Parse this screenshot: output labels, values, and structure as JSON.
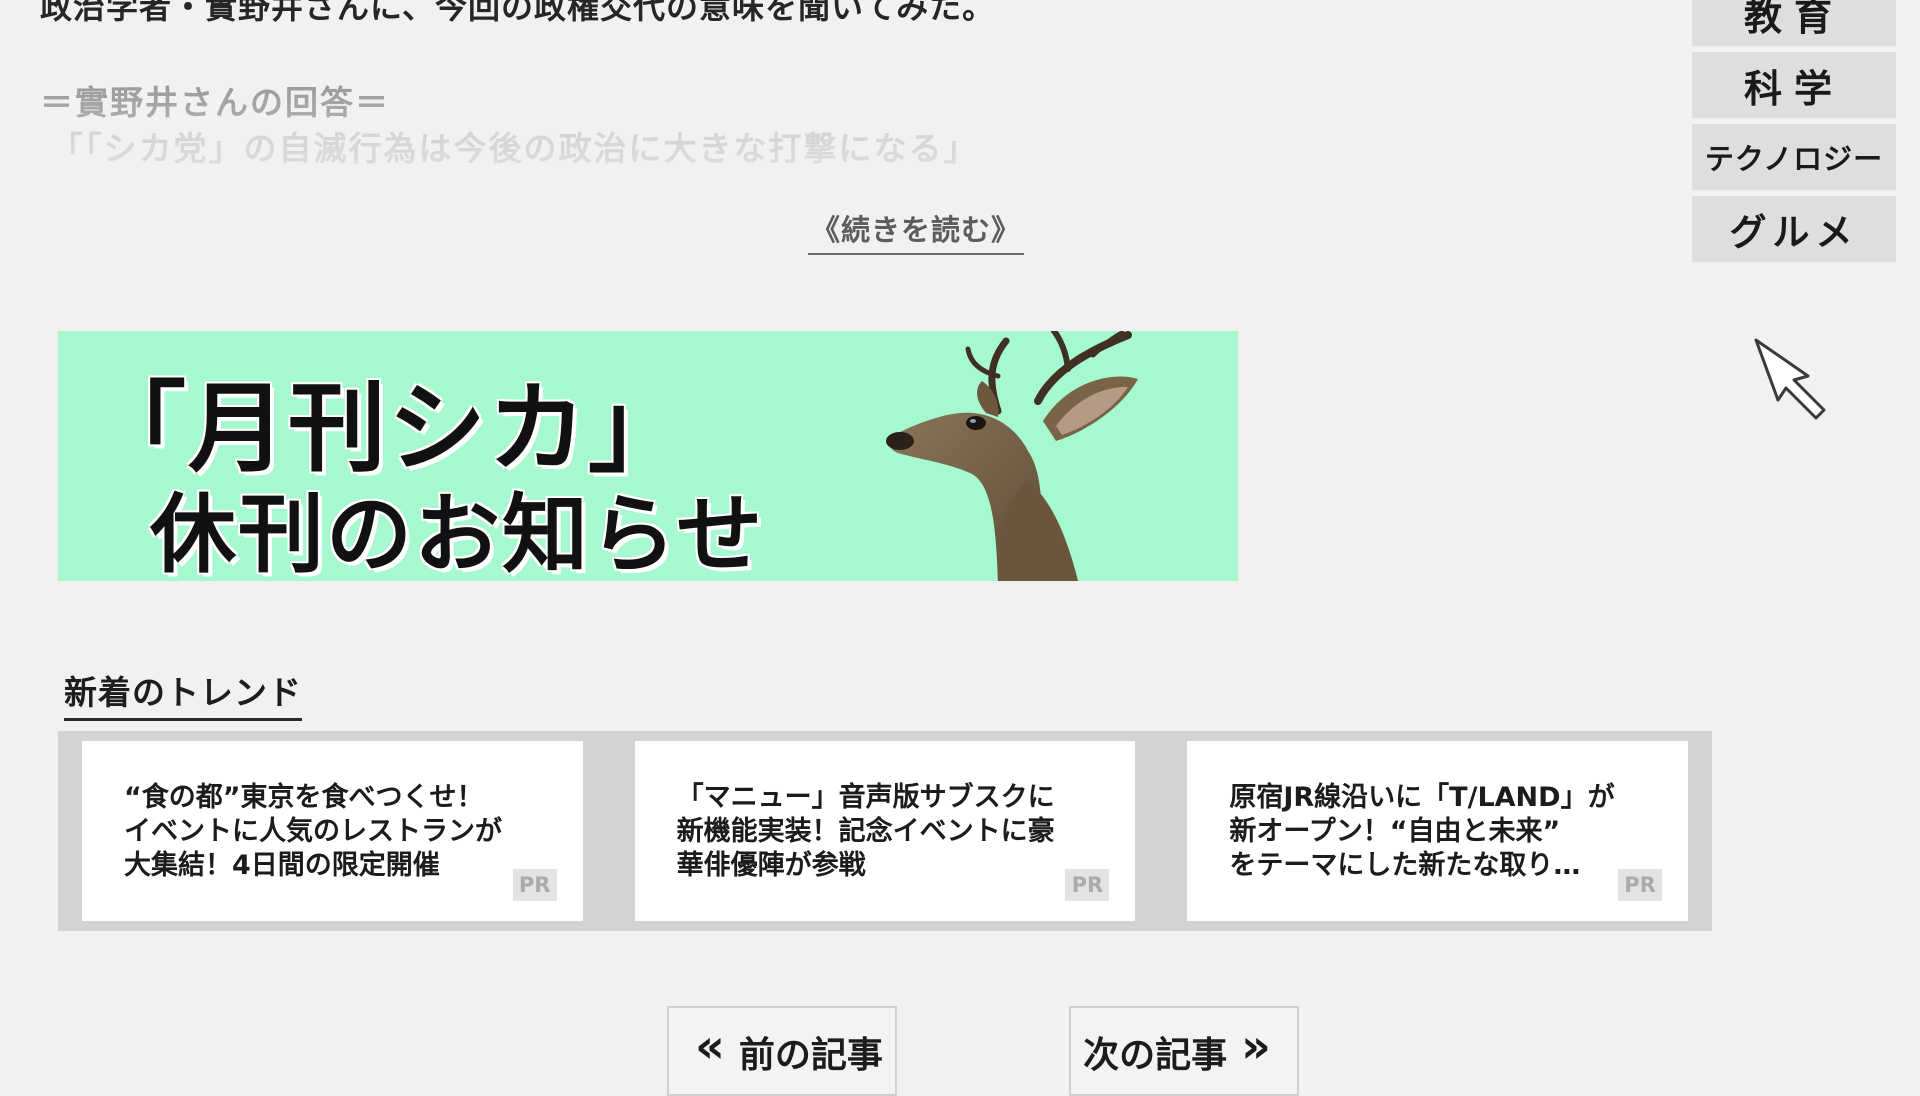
{
  "article": {
    "lead": "政治学者・實野井さんに、今回の政権交代の意味を聞いてみた。",
    "answer_heading": "＝實野井さんの回答＝",
    "answer_quote": "「「シカ党」の自滅行為は今後の政治に大きな打撃になる」",
    "read_more": "《続きを読む》"
  },
  "categories": [
    "教育",
    "科学",
    "テクノロジー",
    "グルメ"
  ],
  "banner": {
    "title": "「月刊シカ」",
    "subtitle": "休刊のお知らせ",
    "background": "#a6f8cf"
  },
  "trends": {
    "title": "新着のトレンド",
    "cards": [
      {
        "line1": "“食の都”東京を食べつくせ！",
        "line2": "イベントに人気のレストランが",
        "line3": "大集結！4日間の限定開催",
        "badge": "PR"
      },
      {
        "line1": "「マニュー」音声版サブスクに",
        "line2": "新機能実装！記念イベントに豪",
        "line3": "華俳優陣が参戦",
        "badge": "PR"
      },
      {
        "line1": "原宿JR線沿いに「T/LAND」が",
        "line2": "新オープン！“自由と未来”",
        "line3": "をテーマにした新たな取り…",
        "badge": "PR"
      }
    ]
  },
  "nav": {
    "prev": "前の記事",
    "next": "次の記事",
    "prev_icon": "«",
    "next_icon": "»"
  },
  "icons": {
    "cursor": "mouse-pointer-icon",
    "deer": "deer-head-icon"
  }
}
